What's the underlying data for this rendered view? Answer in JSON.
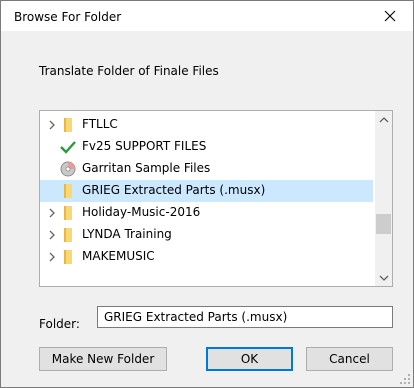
{
  "window": {
    "title": "Browse For Folder",
    "close_icon": "close-icon"
  },
  "instruction": "Translate Folder of Finale Files",
  "tree": {
    "items": [
      {
        "label": "FTLLC",
        "icon": "folder-icon",
        "expandable": true,
        "selected": false
      },
      {
        "label": "Fv25 SUPPORT FILES",
        "icon": "checkmark-icon",
        "expandable": false,
        "selected": false
      },
      {
        "label": "Garritan Sample Files",
        "icon": "disc-icon",
        "expandable": false,
        "selected": false
      },
      {
        "label": "GRIEG Extracted Parts (.musx)",
        "icon": "folder-icon",
        "expandable": false,
        "selected": true
      },
      {
        "label": "Holiday-Music-2016",
        "icon": "folder-icon",
        "expandable": true,
        "selected": false
      },
      {
        "label": "LYNDA Training",
        "icon": "folder-icon",
        "expandable": true,
        "selected": false
      },
      {
        "label": "MAKEMUSIC",
        "icon": "folder-icon",
        "expandable": true,
        "selected": false
      }
    ]
  },
  "folder_field": {
    "label": "Folder:",
    "value": "GRIEG Extracted Parts (.musx)"
  },
  "buttons": {
    "make_new_folder": "Make New Folder",
    "ok": "OK",
    "cancel": "Cancel"
  },
  "colors": {
    "selection": "#cce8ff",
    "folder": "#f8d775",
    "check": "#2b9a3a",
    "accent": "#0078d7"
  }
}
